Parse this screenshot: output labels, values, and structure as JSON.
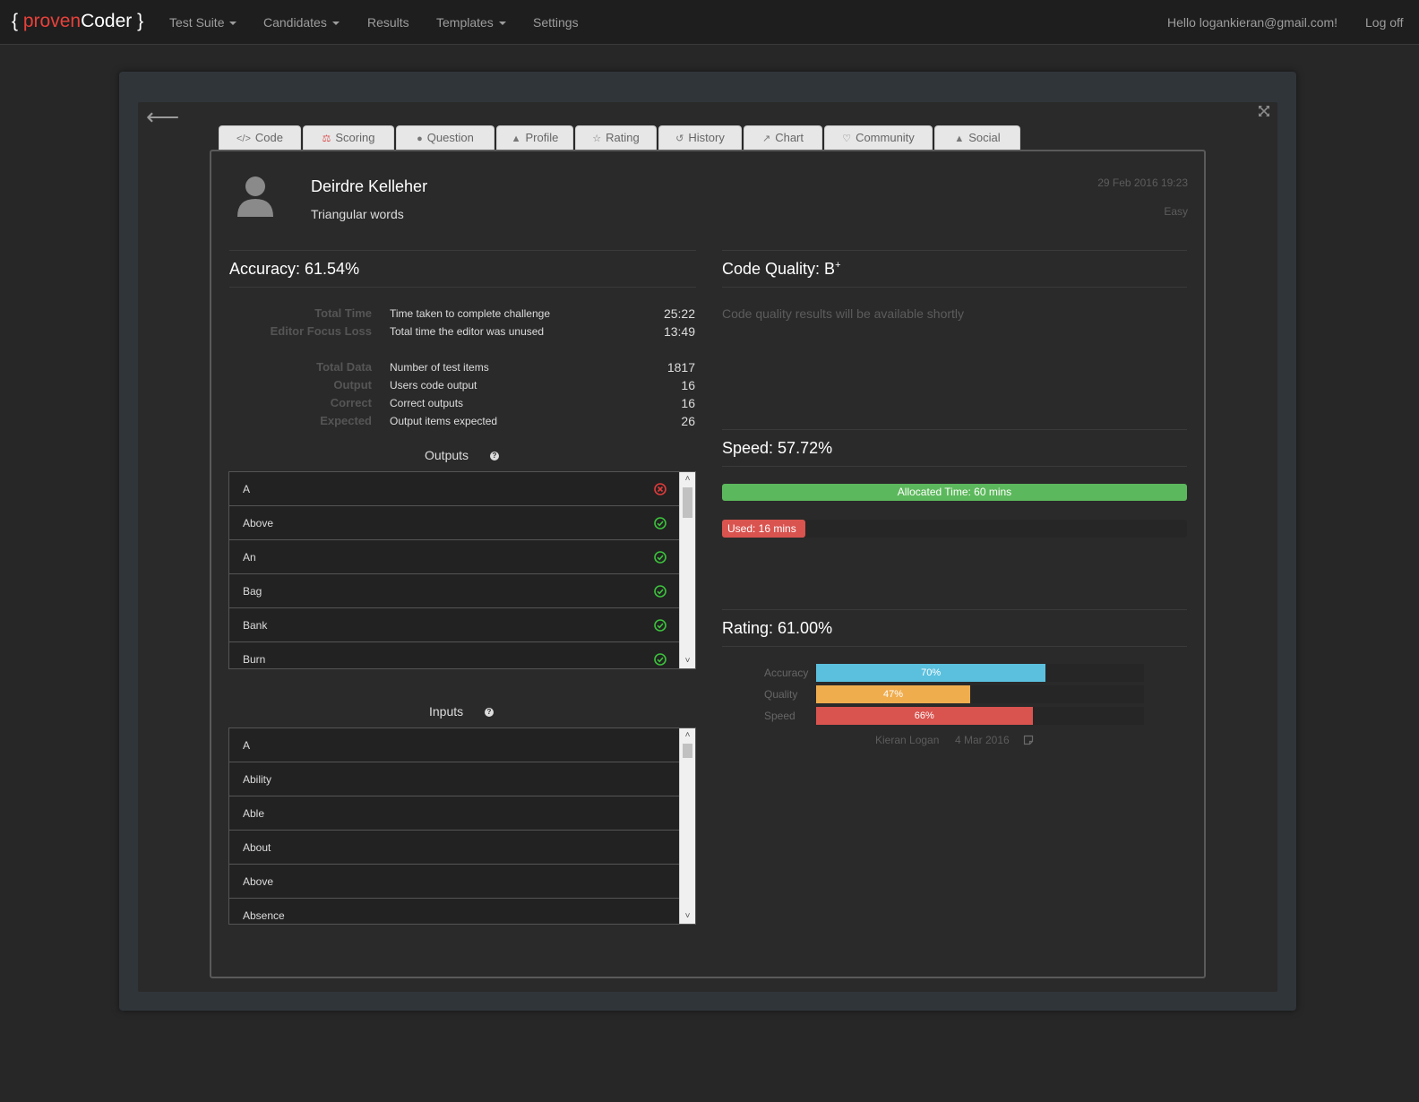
{
  "nav": {
    "brand_open": "{ ",
    "brand_accent": "proven",
    "brand_rest": "Coder }",
    "items": [
      {
        "label": "Test Suite",
        "dropdown": true
      },
      {
        "label": "Candidates",
        "dropdown": true
      },
      {
        "label": "Results",
        "dropdown": false
      },
      {
        "label": "Templates",
        "dropdown": true
      },
      {
        "label": "Settings",
        "dropdown": false
      }
    ],
    "greeting": "Hello logankieran@gmail.com!",
    "logoff": "Log off"
  },
  "modal": {
    "back_icon": "arrow-left-icon",
    "expand_icon": "expand-icon"
  },
  "tabs": [
    {
      "label": "Code",
      "icon": "code-icon"
    },
    {
      "label": "Scoring",
      "icon": "scale-icon",
      "color": "#d9534f"
    },
    {
      "label": "Question",
      "icon": "circle-icon"
    },
    {
      "label": "Profile",
      "icon": "user-icon"
    },
    {
      "label": "Rating",
      "icon": "star-icon"
    },
    {
      "label": "History",
      "icon": "history-icon"
    },
    {
      "label": "Chart",
      "icon": "line-chart-icon"
    },
    {
      "label": "Community",
      "icon": "heart-icon"
    },
    {
      "label": "Social",
      "icon": "users-icon"
    }
  ],
  "candidate": {
    "name": "Deirdre Kelleher",
    "task": "Triangular words",
    "date": "29 Feb 2016 19:23",
    "difficulty": "Easy"
  },
  "accuracy": {
    "title": "Accuracy: 61.54%",
    "stats": [
      {
        "label": "Total Time",
        "desc": "Time taken to complete challenge",
        "value": "25:22"
      },
      {
        "label": "Editor Focus Loss",
        "desc": "Total time the editor was unused",
        "value": "13:49"
      },
      {
        "label": "Total Data",
        "desc": "Number of test items",
        "value": "1817"
      },
      {
        "label": "Output",
        "desc": "Users code output",
        "value": "16"
      },
      {
        "label": "Correct",
        "desc": "Correct outputs",
        "value": "16"
      },
      {
        "label": "Expected",
        "desc": "Output items expected",
        "value": "26"
      }
    ]
  },
  "outputs": {
    "title": "Outputs",
    "help_icon": "question-icon",
    "items": [
      {
        "text": "A",
        "status": "wrong"
      },
      {
        "text": "Above",
        "status": "correct"
      },
      {
        "text": "An",
        "status": "correct"
      },
      {
        "text": "Bag",
        "status": "correct"
      },
      {
        "text": "Bank",
        "status": "correct"
      },
      {
        "text": "Burn",
        "status": "correct"
      }
    ],
    "scroll_position": 0.0
  },
  "inputs": {
    "title": "Inputs",
    "help_icon": "question-icon",
    "items": [
      "A",
      "Ability",
      "Able",
      "About",
      "Above",
      "Absence"
    ],
    "scroll_position": 0.0
  },
  "code_quality": {
    "title_prefix": "Code Quality: B",
    "title_sup": "+",
    "message": "Code quality results will be available shortly"
  },
  "speed": {
    "title": "Speed: 57.72%",
    "allocated_label": "Allocated Time: 60 mins",
    "used_label": "Used: 16 mins",
    "used_fraction": 0.18,
    "colors": {
      "allocated": "#5cb85c",
      "used": "#d9534f"
    }
  },
  "rating": {
    "title": "Rating: 61.00%",
    "bars": [
      {
        "label": "Accuracy",
        "value": 70,
        "text": "70%",
        "color": "#5bc0de"
      },
      {
        "label": "Quality",
        "value": 47,
        "text": "47%",
        "color": "#f0ad4e"
      },
      {
        "label": "Speed",
        "value": 66,
        "text": "66%",
        "color": "#d9534f"
      }
    ],
    "rater": "Kieran Logan",
    "rated_on": "4 Mar 2016",
    "note_icon": "note-icon"
  }
}
